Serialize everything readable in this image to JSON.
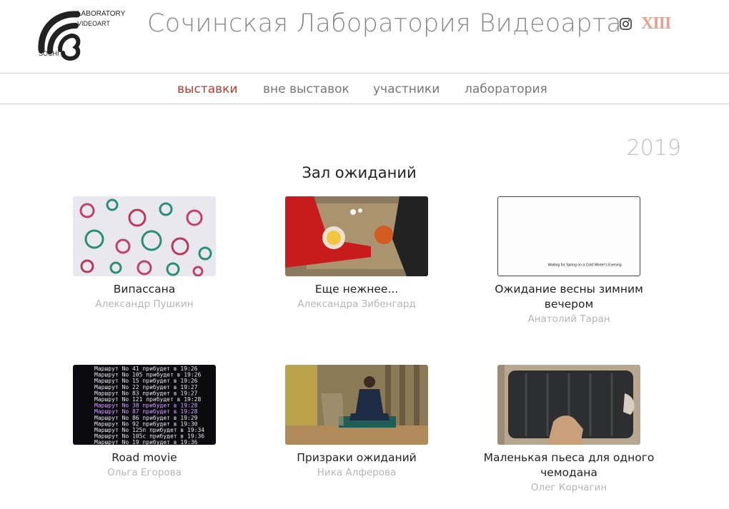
{
  "header": {
    "site_title": "Сочинская Лаборатория Видеоарта",
    "logo": {
      "line1": "LABORATORY",
      "line2": "VIDEOART",
      "line3": "SOCHI"
    },
    "social": {
      "instagram_icon": "instagram-icon",
      "badge": "XIII",
      "badge_color": "#e6a08d"
    }
  },
  "nav": {
    "items": [
      {
        "label": "выставки",
        "active": true
      },
      {
        "label": "вне выставок",
        "active": false
      },
      {
        "label": "участники",
        "active": false
      },
      {
        "label": "лаборатория",
        "active": false
      }
    ],
    "active_color": "#c0392b"
  },
  "main": {
    "year": "2019",
    "section_title": "Зал ожиданий",
    "works": [
      {
        "title": "Випассана",
        "author": "Александр Пушкин"
      },
      {
        "title": "Еще нежнее...",
        "author": "Александра Зибенгард"
      },
      {
        "title": "Ожидание весны зимним вечером",
        "author": "Анатолий Таран",
        "thumb_caption": "Waiting for Spring on a Cold Winter's Evening"
      },
      {
        "title": "Road movie",
        "author": "Ольга Егорова",
        "thumb_lines": [
          "Маршрут No 41 прибудет в 19:26",
          "Маршрут No 105 прибудет в 19:26",
          "Маршрут No 15 прибудет в 19:26",
          "Маршрут No 22 прибудет в 19:27",
          "Маршрут No 83 прибудет в 19:27",
          "Маршрут No 121 прибудет в 19:28",
          "Маршрут No 38 прибудет в 19:28",
          "Маршрут No 87 прибудет в 19:28",
          "Маршрут No 86 прибудет в 19:29",
          "Маршрут No 92 прибудет в 19:30",
          "Маршрут No 125п прибудет в 19:34",
          "Маршрут No 105с прибудет в 19:36",
          "Маршрут No 19 прибудет в 19:36"
        ]
      },
      {
        "title": "Призраки ожиданий",
        "author": "Ника Алферова"
      },
      {
        "title": "Маленькая пьеса для одного чемодана",
        "author": "Олег Корчагин"
      }
    ]
  }
}
